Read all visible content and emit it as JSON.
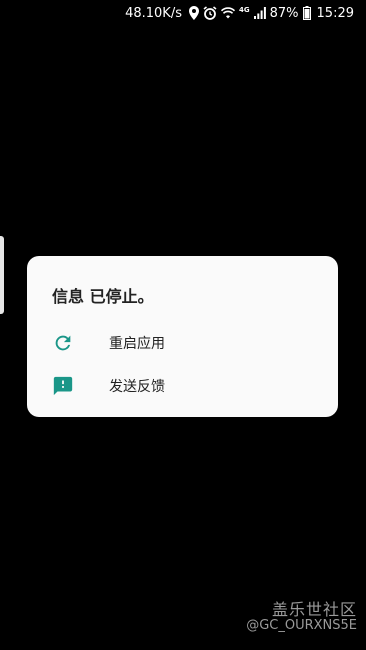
{
  "status_bar": {
    "net_speed": "48.10K/s",
    "network_type": "4G",
    "battery": "87%",
    "time": "15:29",
    "icons": [
      "location-icon",
      "alarm-icon",
      "wifi-icon",
      "signal-icon",
      "battery-icon"
    ]
  },
  "dialog": {
    "title": "信息 已停止。",
    "items": [
      {
        "label": "重启应用",
        "icon": "refresh-icon"
      },
      {
        "label": "发送反馈",
        "icon": "feedback-icon"
      }
    ],
    "accent_color": "#1a9688"
  },
  "watermark": {
    "title": "盖乐世社区",
    "handle": "@GC_OURXNS5E"
  }
}
